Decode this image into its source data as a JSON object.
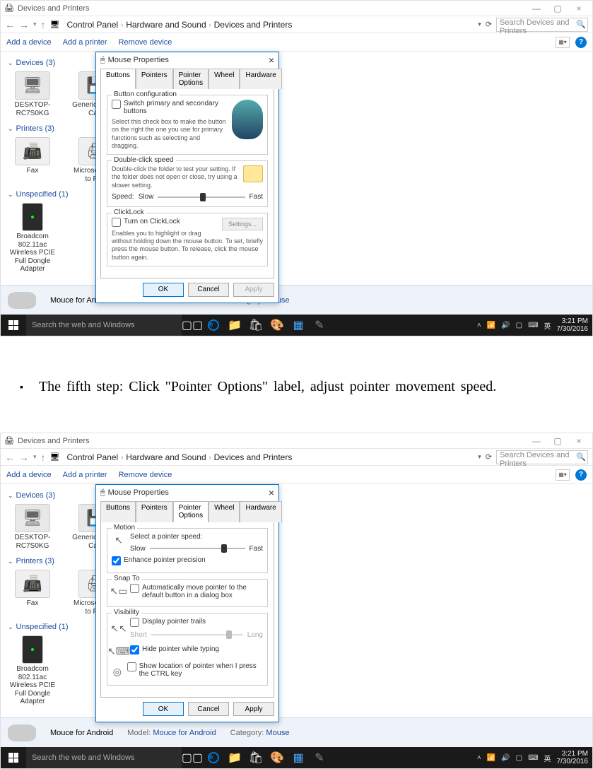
{
  "window": {
    "title": "Devices and Printers",
    "minimize": "—",
    "maximize": "▢",
    "close": "×"
  },
  "nav": {
    "back": "←",
    "forward": "→",
    "up": "↑",
    "dropdown": "▾",
    "refresh": "⟳"
  },
  "breadcrumb": {
    "a": "Control Panel",
    "b": "Hardware and Sound",
    "c": "Devices and Printers",
    "sep": "›"
  },
  "search": {
    "placeholder": "Search Devices and Printers"
  },
  "commands": {
    "add_device": "Add a device",
    "add_printer": "Add a printer",
    "remove_device": "Remove device",
    "help": "?"
  },
  "categories": {
    "devices": "Devices (3)",
    "printers": "Printers (3)",
    "unspecified": "Unspecified (1)"
  },
  "devices": [
    {
      "name": "DESKTOP-RC7S0KG"
    },
    {
      "name": "Generic SS168 Card"
    }
  ],
  "printers": [
    {
      "name": "Fax"
    },
    {
      "name": "Microsoft Print to PDF"
    }
  ],
  "unspecified": [
    {
      "name": "Broadcom 802.11ac Wireless PCIE Full Dongle Adapter"
    }
  ],
  "details": {
    "device_name": "Mouce for Android",
    "model_label": "Model:",
    "model_value": "Mouce for Android",
    "category_label": "Category:",
    "category_value": "Mouse"
  },
  "taskbar": {
    "search": "Search the web and Windows",
    "ime": "英",
    "time": "3:21 PM",
    "date": "7/30/2016"
  },
  "dialog1": {
    "title": "Mouse Properties",
    "tabs": {
      "buttons": "Buttons",
      "pointers": "Pointers",
      "pointer_options": "Pointer Options",
      "wheel": "Wheel",
      "hardware": "Hardware"
    },
    "buttonconfig": {
      "legend": "Button configuration",
      "switch": "Switch primary and secondary buttons",
      "desc": "Select this check box to make the button on the right the one you use for primary functions such as selecting and dragging."
    },
    "dblclick": {
      "legend": "Double-click speed",
      "desc": "Double-click the folder to test your setting. If the folder does not open or close, try using a slower setting.",
      "speed_label": "Speed:",
      "slow": "Slow",
      "fast": "Fast"
    },
    "clicklock": {
      "legend": "ClickLock",
      "turn_on": "Turn on ClickLock",
      "settings": "Settings...",
      "desc": "Enables you to highlight or drag without holding down the mouse button. To set, briefly press the mouse button. To release, click the mouse button again."
    },
    "ok": "OK",
    "cancel": "Cancel",
    "apply": "Apply"
  },
  "dialog2": {
    "title": "Mouse Properties",
    "tabs": {
      "buttons": "Buttons",
      "pointers": "Pointers",
      "pointer_options": "Pointer Options",
      "wheel": "Wheel",
      "hardware": "Hardware"
    },
    "motion": {
      "legend": "Motion",
      "select": "Select a pointer speed:",
      "slow": "Slow",
      "fast": "Fast",
      "enhance": "Enhance pointer precision"
    },
    "snapto": {
      "legend": "Snap To",
      "auto": "Automatically move pointer to the default button in a dialog box"
    },
    "visibility": {
      "legend": "Visibility",
      "trails": "Display pointer trails",
      "short": "Short",
      "long": "Long",
      "hide": "Hide pointer while typing",
      "ctrl": "Show location of pointer when I press the CTRL key"
    },
    "ok": "OK",
    "cancel": "Cancel",
    "apply": "Apply"
  },
  "instruction": {
    "bullet": "▪",
    "text": "The fifth step: Click \"Pointer Options\" label, adjust pointer movement speed."
  }
}
